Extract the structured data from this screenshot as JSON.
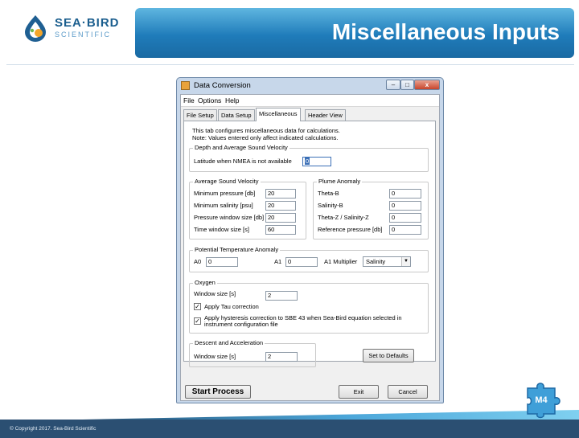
{
  "slide": {
    "title": "Miscellaneous Inputs",
    "logo_line1": "SEA·BIRD",
    "logo_line2": "SCIENTIFIC",
    "copyright": "© Copyright 2017. Sea-Bird Scientific",
    "module_badge": "M4"
  },
  "window": {
    "title": "Data Conversion",
    "controls": {
      "minimize": "–",
      "maximize": "□",
      "close": "x"
    }
  },
  "menu": {
    "items": [
      "File",
      "Options",
      "Help"
    ]
  },
  "tabs": [
    {
      "label": "File Setup",
      "active": false
    },
    {
      "label": "Data Setup",
      "active": false
    },
    {
      "label": "Miscellaneous",
      "active": true
    },
    {
      "label": "Header View",
      "active": false
    }
  ],
  "intro": {
    "line1": "This tab configures miscellaneous data for calculations.",
    "line2": "Note: Values entered only affect indicated calculations."
  },
  "depth": {
    "title": "Depth and Average Sound Velocity",
    "latitude_label": "Latitude when NMEA is not available",
    "latitude_value": "0"
  },
  "avg_sound": {
    "title": "Average Sound Velocity",
    "fields": [
      {
        "label": "Minimum pressure [db]",
        "value": "20"
      },
      {
        "label": "Minimum salinity [psu]",
        "value": "20"
      },
      {
        "label": "Pressure window size [db]",
        "value": "20"
      },
      {
        "label": "Time window size [s]",
        "value": "60"
      }
    ]
  },
  "plume": {
    "title": "Plume Anomaly",
    "fields": [
      {
        "label": "Theta-B",
        "value": "0"
      },
      {
        "label": "Salinity-B",
        "value": "0"
      },
      {
        "label": "Theta-Z / Salinity-Z",
        "value": "0"
      },
      {
        "label": "Reference pressure [db]",
        "value": "0"
      }
    ]
  },
  "potential_temp": {
    "title": "Potential Temperature Anomaly",
    "a0_label": "A0",
    "a0_value": "0",
    "a1_label": "A1",
    "a1_value": "0",
    "multiplier_label": "A1 Multiplier",
    "multiplier_value": "Salinity"
  },
  "oxygen": {
    "title": "Oxygen",
    "window_label": "Window size [s]",
    "window_value": "2",
    "tau_label": "Apply Tau correction",
    "tau_checked": true,
    "hysteresis_line1": "Apply hysteresis correction to SBE 43 when Sea-Bird equation selected in",
    "hysteresis_line2": "instrument configuration file",
    "hysteresis_checked": true
  },
  "descent": {
    "title": "Descent and Acceleration",
    "window_label": "Window size [s]",
    "window_value": "2"
  },
  "buttons": {
    "defaults": "Set to Defaults",
    "start": "Start Process",
    "exit": "Exit",
    "cancel": "Cancel"
  },
  "colors": {
    "title_bar": "#1f7cba",
    "footer": "#2b4f72",
    "puzzle": "#3f9fd8"
  }
}
